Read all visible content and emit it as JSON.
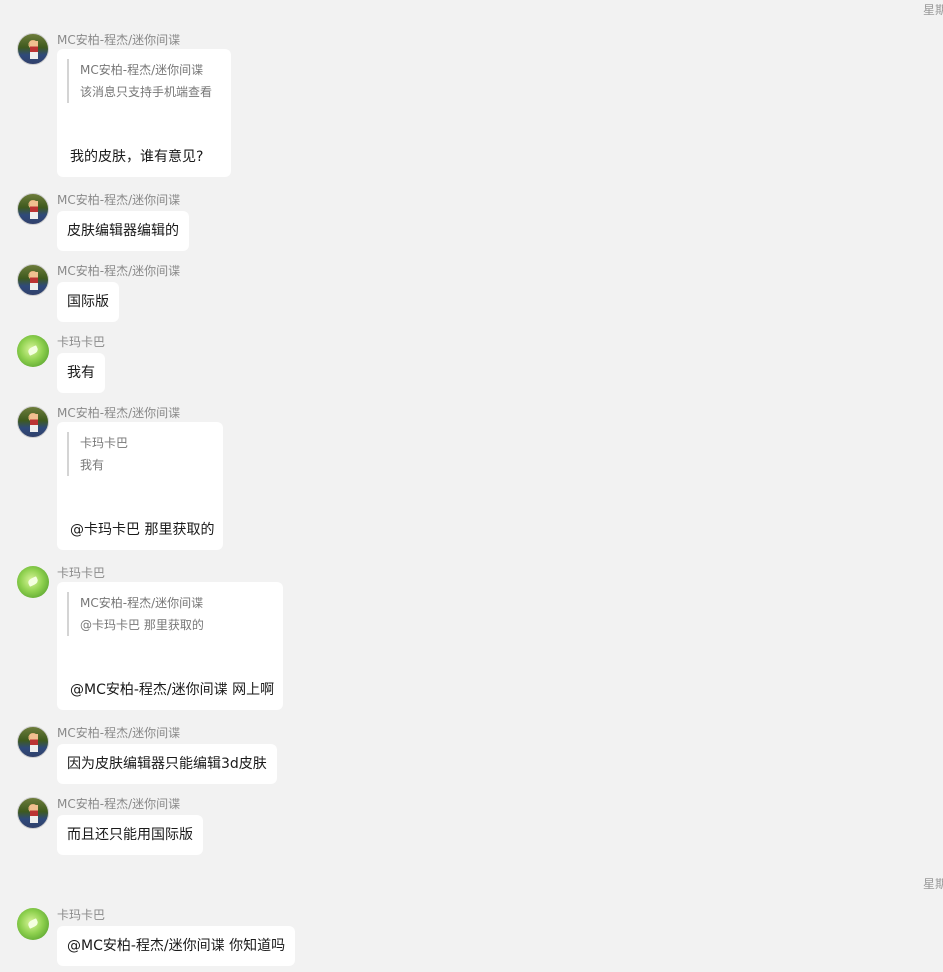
{
  "timestamps": [
    "星期",
    "星期"
  ],
  "messages": [
    {
      "sender": "MC安柏-程杰/迷你间谍",
      "quote": {
        "author": "MC安柏-程杰/迷你间谍",
        "text": "该消息只支持手机端查看"
      },
      "text": "我的皮肤，谁有意见?"
    },
    {
      "sender": "MC安柏-程杰/迷你间谍",
      "text": "皮肤编辑器编辑的"
    },
    {
      "sender": "MC安柏-程杰/迷你间谍",
      "text": "国际版"
    },
    {
      "sender": "卡玛卡巴",
      "text": "我有"
    },
    {
      "sender": "MC安柏-程杰/迷你间谍",
      "quote": {
        "author": "卡玛卡巴",
        "text": "我有"
      },
      "text": "@卡玛卡巴 那里获取的"
    },
    {
      "sender": "卡玛卡巴",
      "quote": {
        "author": "MC安柏-程杰/迷你间谍",
        "text": "@卡玛卡巴 那里获取的"
      },
      "text": "@MC安柏-程杰/迷你间谍 网上啊"
    },
    {
      "sender": "MC安柏-程杰/迷你间谍",
      "text": "因为皮肤编辑器只能编辑3d皮肤"
    },
    {
      "sender": "MC安柏-程杰/迷你间谍",
      "text": "而且还只能用国际版"
    },
    {
      "sender": "卡玛卡巴",
      "text": "@MC安柏-程杰/迷你间谍 你知道吗"
    }
  ]
}
